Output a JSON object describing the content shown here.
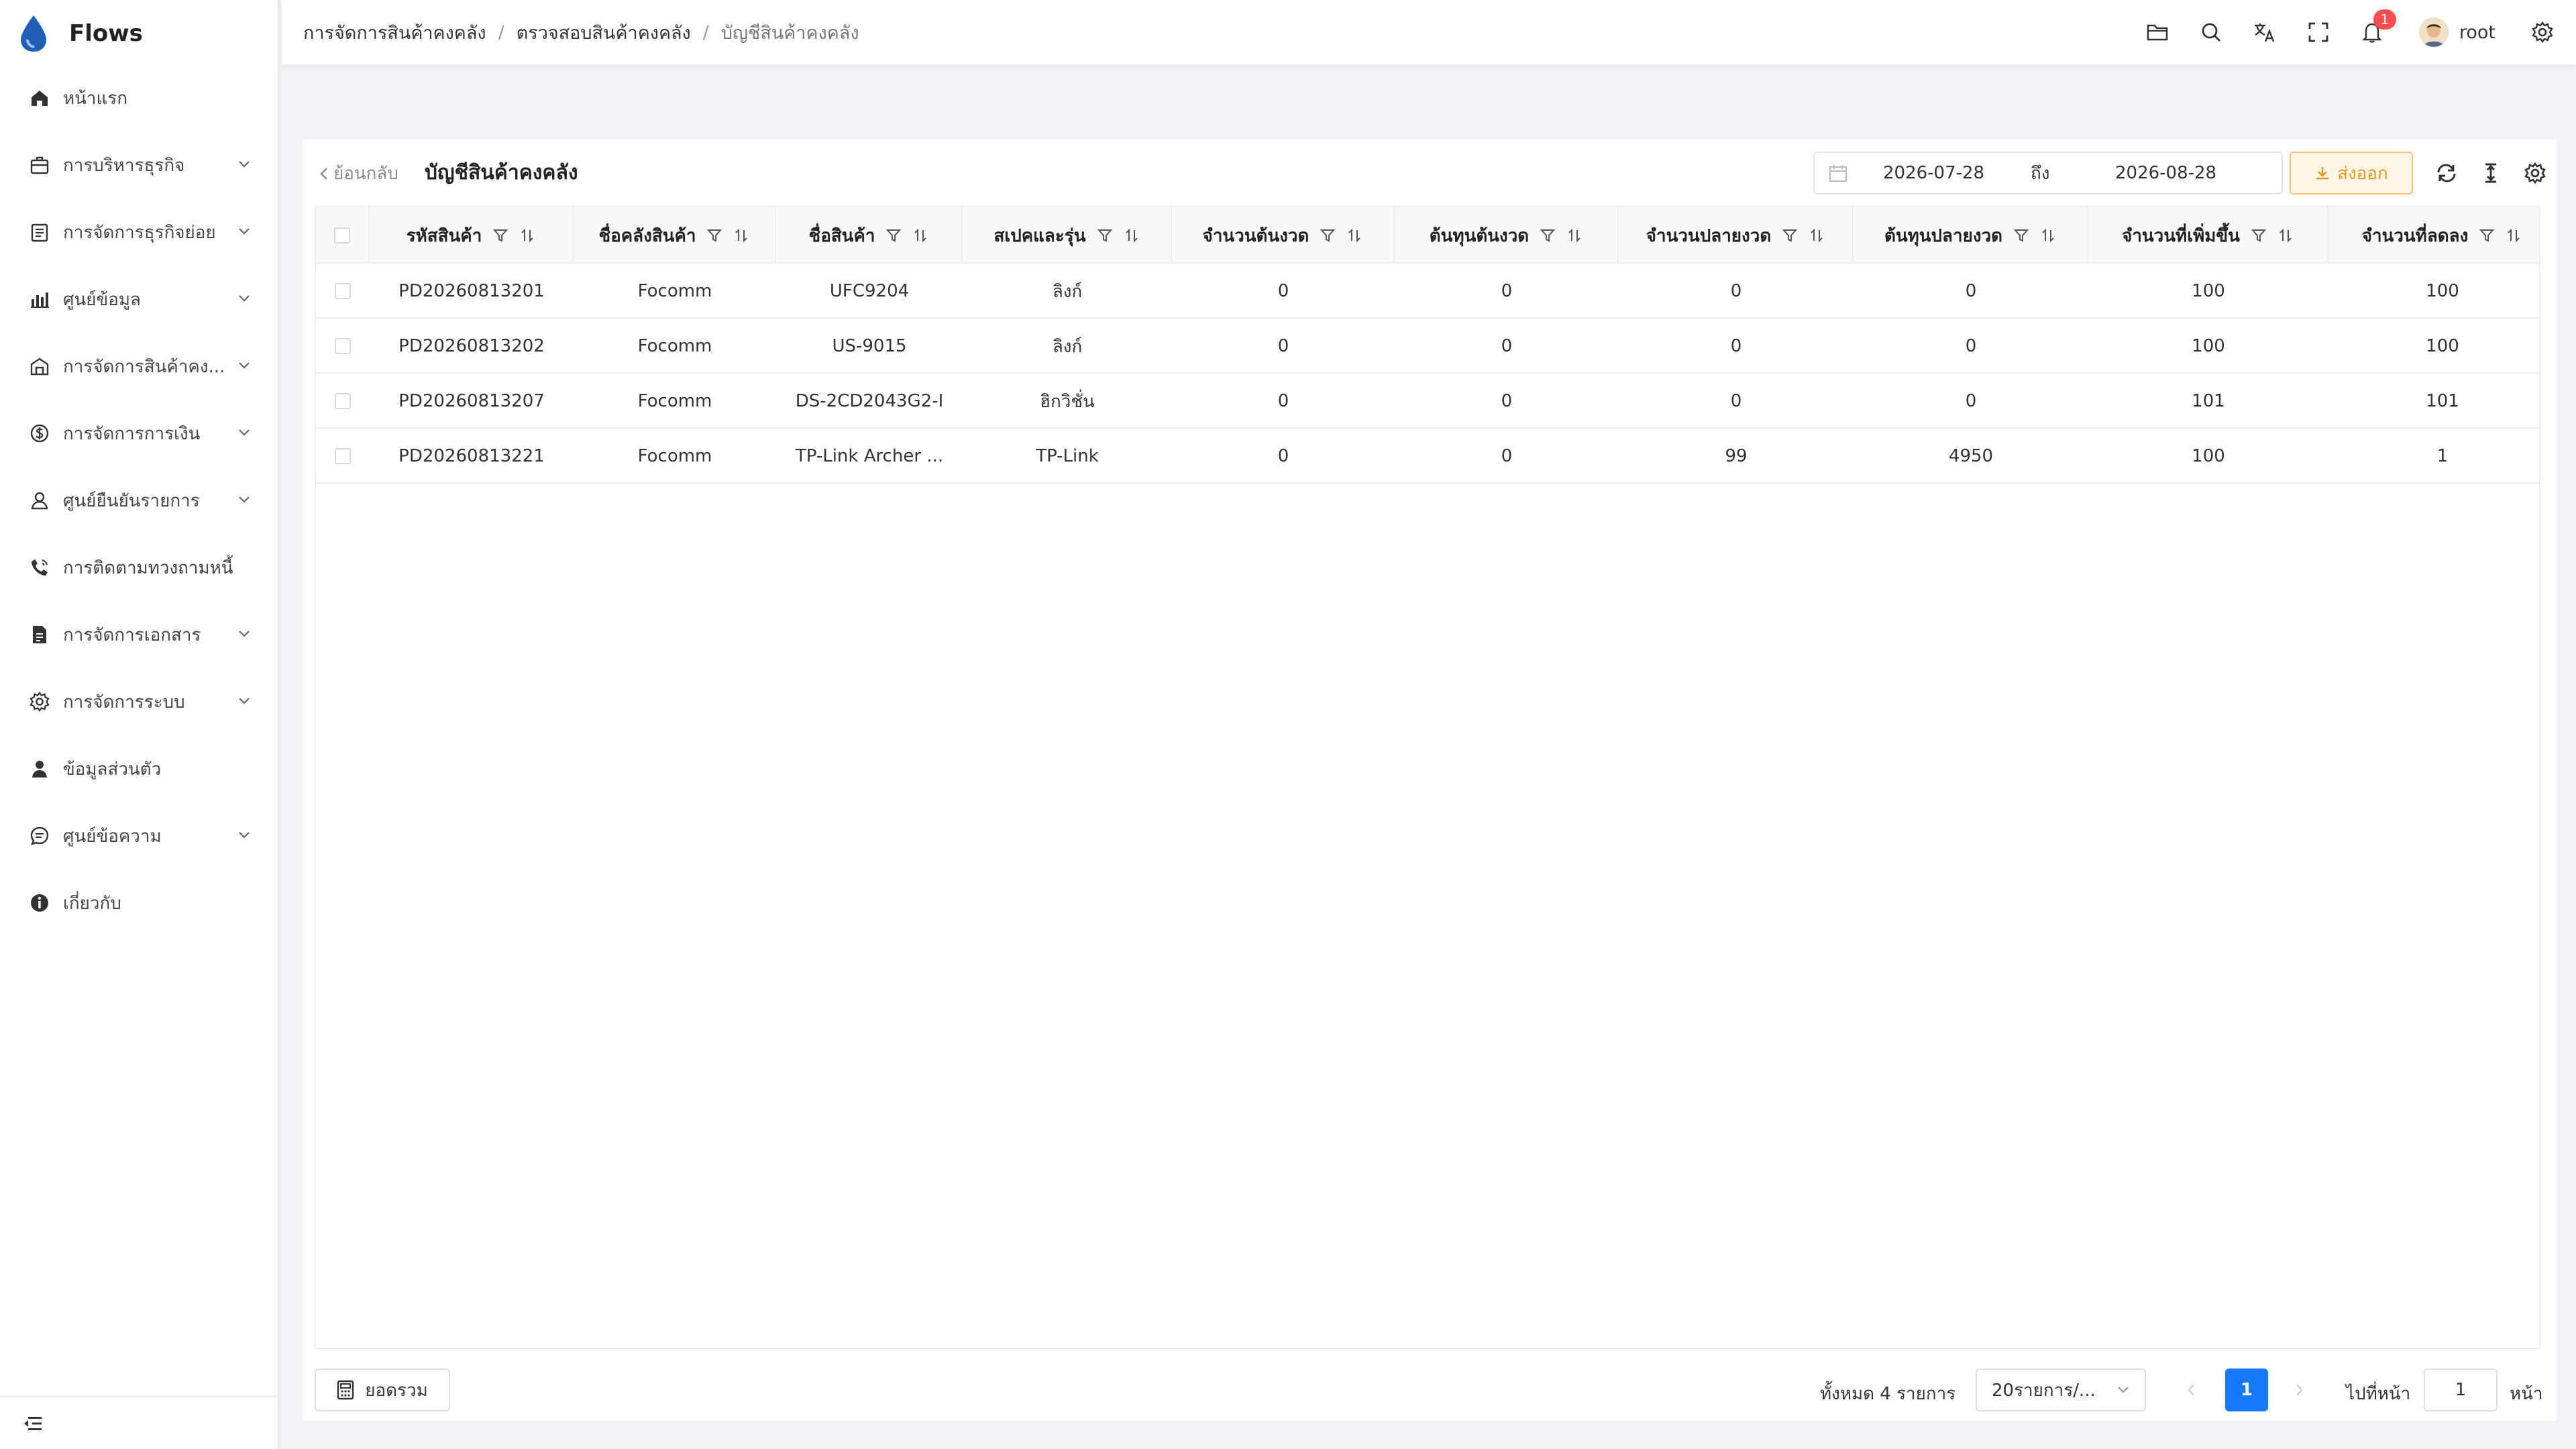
{
  "app": {
    "name": "Flows"
  },
  "sidebar": {
    "items": [
      {
        "label": "หน้าแรก",
        "icon": "home-icon",
        "has_children": false
      },
      {
        "label": "การบริหารธุรกิจ",
        "icon": "briefcase-icon",
        "has_children": true
      },
      {
        "label": "การจัดการธุรกิจย่อย",
        "icon": "clipboard-icon",
        "has_children": true
      },
      {
        "label": "ศูนย์ข้อมูล",
        "icon": "bar-chart-icon",
        "has_children": true
      },
      {
        "label": "การจัดการสินค้าคง...",
        "icon": "warehouse-icon",
        "has_children": true
      },
      {
        "label": "การจัดการการเงิน",
        "icon": "dollar-icon",
        "has_children": true
      },
      {
        "label": "ศูนย์ยืนยันรายการ",
        "icon": "user-check-icon",
        "has_children": true
      },
      {
        "label": "การติดตามทวงถามหนี้",
        "icon": "phone-icon",
        "has_children": false
      },
      {
        "label": "การจัดการเอกสาร",
        "icon": "document-icon",
        "has_children": true
      },
      {
        "label": "การจัดการระบบ",
        "icon": "gear-icon",
        "has_children": true
      },
      {
        "label": "ข้อมูลส่วนตัว",
        "icon": "person-icon",
        "has_children": false
      },
      {
        "label": "ศูนย์ข้อความ",
        "icon": "message-icon",
        "has_children": true
      },
      {
        "label": "เกี่ยวกับ",
        "icon": "info-icon",
        "has_children": false
      }
    ]
  },
  "header": {
    "breadcrumb": [
      "การจัดการสินค้าคงคลัง",
      "ตรวจสอบสินค้าคงคลัง",
      "บัญชีสินค้าคงคลัง"
    ],
    "notification_count": "1",
    "username": "root"
  },
  "toolbar": {
    "back_label": "ย้อนกลับ",
    "title": "บัญชีสินค้าคงคลัง",
    "date_from": "2026-07-28",
    "date_to_label": "ถึง",
    "date_to": "2026-08-28",
    "export_label": "ส่งออก"
  },
  "table": {
    "columns": [
      "รหัสสินค้า",
      "ชื่อคลังสินค้า",
      "ชื่อสินค้า",
      "สเปคและรุ่น",
      "จำนวนต้นงวด",
      "ต้นทุนต้นงวด",
      "จำนวนปลายงวด",
      "ต้นทุนปลายงวด",
      "จำนวนที่เพิ่มขึ้น",
      "จำนวนที่ลดลง"
    ],
    "rows": [
      [
        "PD20260813201",
        "Focomm",
        "UFC9204",
        "ลิงก์",
        "0",
        "0",
        "0",
        "0",
        "100",
        "100"
      ],
      [
        "PD20260813202",
        "Focomm",
        "US-9015",
        "ลิงก์",
        "0",
        "0",
        "0",
        "0",
        "100",
        "100"
      ],
      [
        "PD20260813207",
        "Focomm",
        "DS-2CD2043G2-I",
        "ฮิกวิชั่น",
        "0",
        "0",
        "0",
        "0",
        "101",
        "101"
      ],
      [
        "PD20260813221",
        "Focomm",
        "TP-Link Archer ...",
        "TP-Link",
        "0",
        "0",
        "99",
        "4950",
        "100",
        "1"
      ]
    ]
  },
  "footer": {
    "summary_label": "ยอดรวม",
    "total_text": "ทั้งหมด 4 รายการ",
    "page_size": "20รายการ/...",
    "current_page": "1",
    "goto_label": "ไปที่หน้า",
    "goto_value": "1",
    "goto_suffix": "หน้า"
  },
  "colors": {
    "accent": "#1677ff",
    "export": "#e8951f",
    "badge": "#ff4d4f"
  }
}
